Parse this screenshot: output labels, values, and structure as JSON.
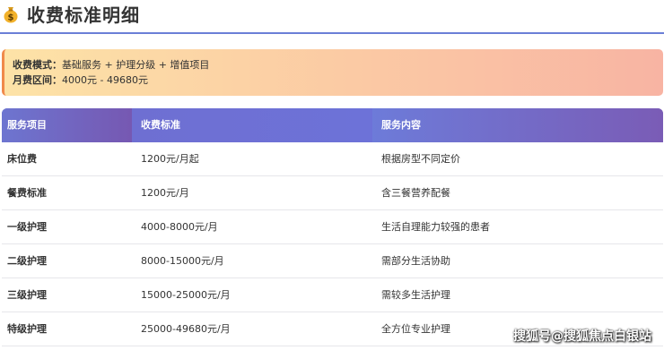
{
  "header": {
    "title": "收费标准明细",
    "icon": "money-bag-icon"
  },
  "info": {
    "mode_label": "收费模式：",
    "mode_value": "基础服务 + 护理分级 + 增值项目",
    "range_label": "月费区间：",
    "range_value": "4000元 - 49680元"
  },
  "table": {
    "columns": [
      "服务项目",
      "收费标准",
      "服务内容"
    ],
    "rows": [
      [
        "床位费",
        "1200元/月起",
        "根据房型不同定价"
      ],
      [
        "餐费标准",
        "1200元/月",
        "含三餐营养配餐"
      ],
      [
        "一级护理",
        "4000-8000元/月",
        "生活自理能力较强的患者"
      ],
      [
        "二级护理",
        "8000-15000元/月",
        "需部分生活协助"
      ],
      [
        "三级护理",
        "15000-25000元/月",
        "需较多生活护理"
      ],
      [
        "特级护理",
        "25000-49680元/月",
        "全方位专业护理"
      ]
    ]
  },
  "watermark": "搜狐号@搜狐焦点白银站",
  "colors": {
    "accent": "#6b7fd7",
    "header_gradient_start": "#6c79d8",
    "header_gradient_end": "#7a58b4",
    "info_gradient_start": "#fde3a7",
    "info_gradient_end": "#f8b4a3"
  }
}
